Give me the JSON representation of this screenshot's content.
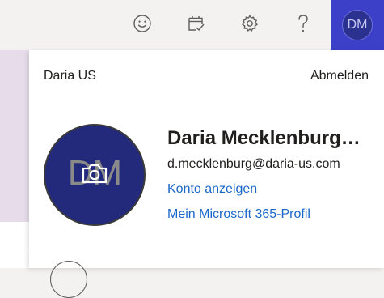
{
  "header": {
    "icons": [
      "smiley-icon",
      "calendar-check-icon",
      "gear-icon",
      "question-icon"
    ],
    "account_initials": "DM"
  },
  "flyout": {
    "org_name": "Daria US",
    "signout_label": "Abmelden",
    "avatar_initials": "DM",
    "display_name": "Daria Mecklenburg…",
    "email": "d.mecklenburg@daria-us.com",
    "links": {
      "view_account": "Konto anzeigen",
      "m365_profile": "Mein Microsoft 365-Profil"
    }
  },
  "colors": {
    "accent": "#3c3fc8",
    "avatar_bg": "#232a7c",
    "link": "#1a66c9",
    "header_bg": "#f3f2f1"
  }
}
